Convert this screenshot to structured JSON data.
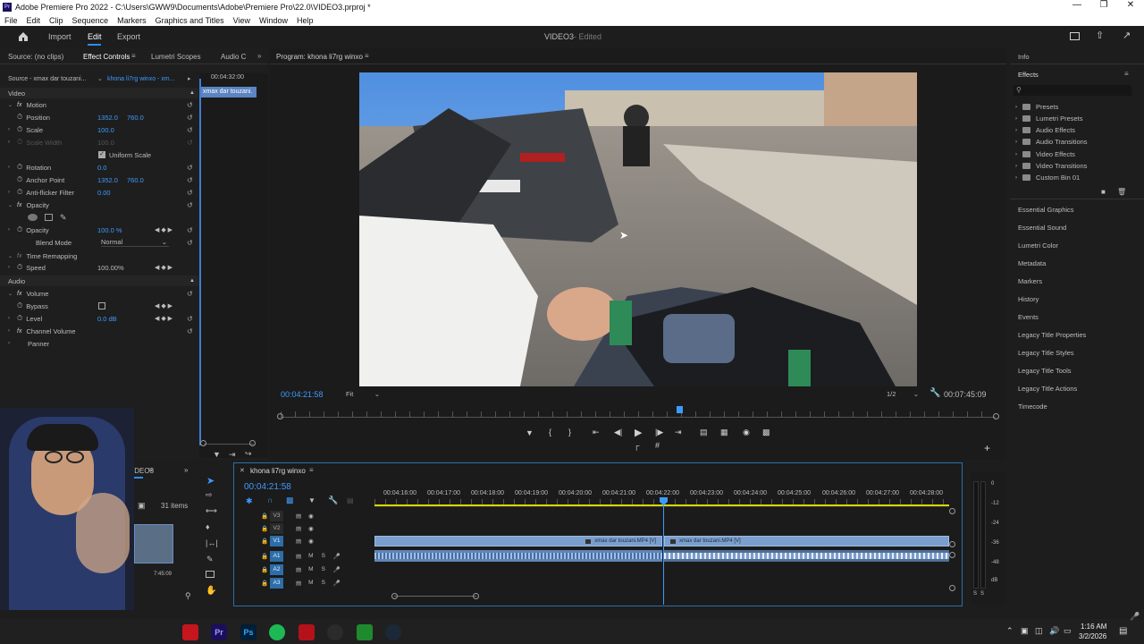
{
  "window": {
    "title": "Adobe Premiere Pro 2022 - C:\\Users\\GWW9\\Documents\\Adobe\\Premiere Pro\\22.0\\VIDEO3.prproj *"
  },
  "menu": [
    "File",
    "Edit",
    "Clip",
    "Sequence",
    "Markers",
    "Graphics and Titles",
    "View",
    "Window",
    "Help"
  ],
  "header": {
    "tabs": [
      "Import",
      "Edit",
      "Export"
    ],
    "active_tab": "Edit",
    "project_name": "VIDEO3",
    "project_status": "- Edited"
  },
  "left_panel": {
    "tabs": [
      "Source: (no clips)",
      "Effect Controls",
      "Lumetri Scopes",
      "Audio C"
    ],
    "source_name": "Source - xmax dar touzani...",
    "sequence_name": "khona li7rg winxo - xm...",
    "timecode": "00:04:32:00",
    "clip_label": "xmax dar touzani.",
    "video_heading": "Video",
    "motion": "Motion",
    "position_label": "Position",
    "position_x": "1352.0",
    "position_y": "760.0",
    "scale_label": "Scale",
    "scale_value": "100.0",
    "scale_width_label": "Scale Width",
    "scale_width_value": "100.0",
    "uniform_scale": "Uniform Scale",
    "rotation_label": "Rotation",
    "rotation_value": "0.0",
    "anchor_label": "Anchor Point",
    "anchor_x": "1352.0",
    "anchor_y": "760.0",
    "antiflicker_label": "Anti-flicker Filter",
    "antiflicker_value": "0.00",
    "opacity_heading": "Opacity",
    "opacity_label": "Opacity",
    "opacity_value": "100.0 %",
    "blend_label": "Blend Mode",
    "blend_value": "Normal",
    "time_remap": "Time Remapping",
    "speed_label": "Speed",
    "speed_value": "100.00%",
    "audio_heading": "Audio",
    "volume_heading": "Volume",
    "bypass_label": "Bypass",
    "level_label": "Level",
    "level_value": "0.0 dB",
    "channel_volume": "Channel Volume",
    "panner": "Panner"
  },
  "project_panel": {
    "tab": "ct: VIDEO3",
    "items": "31 items",
    "thumb_time": "7:45:09"
  },
  "program": {
    "tab": "Program: khona li7rg winxo",
    "timecode": "00:04:21:58",
    "fit": "Fit",
    "resolution": "1/2",
    "duration": "00:07:45:09",
    "scrub_position": 0.558
  },
  "timeline": {
    "tab": "khona li7rg winxo",
    "timecode": "00:04:21:58",
    "ruler": [
      "00:04:16:00",
      "00:04:17:00",
      "00:04:18:00",
      "00:04:19:00",
      "00:04:20:00",
      "00:04:21:00",
      "00:04:22:00",
      "00:04:23:00",
      "00:04:24:00",
      "00:04:25:00",
      "00:04:26:00",
      "00:04:27:00",
      "00:04:28:00"
    ],
    "tracks": [
      "V3",
      "V2",
      "V1",
      "A1",
      "A2",
      "A3"
    ],
    "clip1": "xmax dar touzani.MP4 [V]",
    "clip2": "xmax dar touzani.MP4 [V]",
    "meter_labels": [
      "0",
      "-12",
      "-24",
      "-36",
      "-48",
      "dB"
    ],
    "meter_solo": [
      "S",
      "S"
    ]
  },
  "right_panel": {
    "info": "Info",
    "effects": "Effects",
    "folders": [
      "Presets",
      "Lumetri Presets",
      "Audio Effects",
      "Audio Transitions",
      "Video Effects",
      "Video Transitions",
      "Custom Bin 01"
    ],
    "panels": [
      "Essential Graphics",
      "Essential Sound",
      "Lumetri Color",
      "Metadata",
      "Markers",
      "History",
      "Events",
      "Legacy Title Properties",
      "Legacy Title Styles",
      "Legacy Title Tools",
      "Legacy Title Actions",
      "Timecode"
    ]
  },
  "taskbar": {
    "time": "1:16 AM",
    "date": "3/2/2026",
    "colors": {
      "wps": "#c4161c",
      "premiere": "#1b0f5a",
      "photoshop": "#001e36",
      "spotify": "#1db954",
      "obs": "#2b2b2b",
      "steam": "#1b2838",
      "camtasia": "#1f8a2d"
    }
  }
}
